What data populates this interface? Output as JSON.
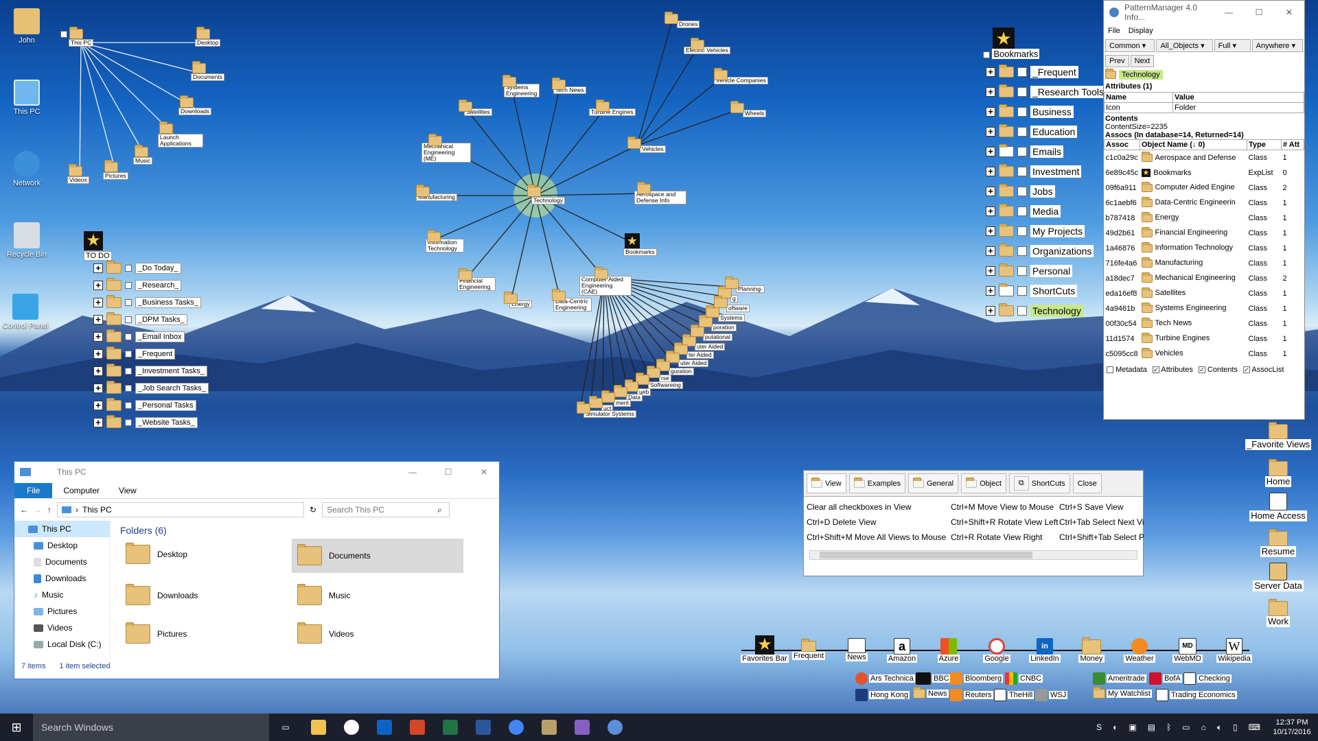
{
  "desktop": {
    "icons": [
      {
        "label": "John"
      },
      {
        "label": "This PC"
      },
      {
        "label": "Network"
      },
      {
        "label": "Recycle Bin"
      },
      {
        "label": "Control Panel"
      }
    ],
    "thispc_tree": {
      "root": "This PC",
      "children": [
        "Desktop",
        "Documents",
        "Downloads",
        "Launch Applications",
        "Music",
        "Pictures",
        "Videos"
      ]
    },
    "todo": {
      "root": "TO DO",
      "items": [
        "_Do Today_",
        "_Research_",
        "_Business Tasks_",
        "_DPM Tasks_",
        "_Email Inbox",
        "_Frequent",
        "_Investment Tasks_",
        "_Job Search Tasks_",
        "_Personal Tasks",
        "_Website Tasks_"
      ]
    },
    "tech_graph": {
      "center": "Technology",
      "nodes": [
        "Drones",
        "Electric Vehicles",
        "Vehicle Companies",
        "Wheels",
        "Vehicles",
        "Tech News",
        "Systems Engineering",
        "Turbine Engines",
        "Satellites",
        "Mechanical Engineering (ME)",
        "Manufacturing",
        "Aerospace and Defense Info",
        "Bookmarks",
        "Information Technology",
        "Financial Engineering",
        "Energy",
        "Data-Centric Engineering",
        "Computer Aided Engineering (CAE)"
      ],
      "cae_children_visible": [
        "Planning-",
        "g",
        "oftware",
        "Systems",
        "poration",
        "putational",
        "uter Aided",
        "ter Aided",
        "uter Aided",
        "guration",
        "rse",
        "Softwareing",
        "ueb",
        "Data",
        "ment",
        "uct",
        "Simulator Systems"
      ]
    },
    "bookmarks": {
      "root": "Bookmarks",
      "items": [
        "_Frequent",
        "_Research Tools",
        "Business",
        "Education",
        "Emails",
        "Investment",
        "Jobs",
        "Media",
        "My Projects",
        "Organizations",
        "Personal",
        "ShortCuts",
        "Technology"
      ]
    },
    "right_column": [
      "_Favorite Views",
      "Home",
      "Home Access",
      "Resume",
      "Server Data",
      "Work"
    ]
  },
  "pattern_manager": {
    "title": "PatternManager 4.0 Info...",
    "menu": [
      "File",
      "Display"
    ],
    "dropdowns": [
      "Common",
      "All_Objects",
      "Full",
      "Anywhere"
    ],
    "prev": "Prev",
    "next": "Next",
    "selected": "Technology",
    "attributes_header": "Attributes (1)",
    "attr_cols": [
      "Name",
      "Value"
    ],
    "attr_row": [
      "Icon",
      "Folder"
    ],
    "contents_header": "Contents",
    "content_size": "ContentSize=2235",
    "assocs_header": "Assocs (In database=14, Returned=14)",
    "assoc_cols": [
      "Assoc",
      "Object Name (↓ 0)",
      "Type",
      "# Att"
    ],
    "assocs": [
      [
        "c1c0a29c",
        "Aerospace and Defense",
        "Class",
        "1"
      ],
      [
        "6e89c45c",
        "Bookmarks",
        "ExpList",
        "0"
      ],
      [
        "09f6a911",
        "Computer Aided Engine",
        "Class",
        "2"
      ],
      [
        "6c1aebf6",
        "Data-Centric Engineerin",
        "Class",
        "1"
      ],
      [
        "b787418",
        "Energy",
        "Class",
        "1"
      ],
      [
        "49d2b61",
        "Financial Engineering",
        "Class",
        "1"
      ],
      [
        "1a46876",
        "Information Technology",
        "Class",
        "1"
      ],
      [
        "716fe4a6",
        "Manufacturing",
        "Class",
        "1"
      ],
      [
        "a18dec7",
        "Mechanical Engineering",
        "Class",
        "2"
      ],
      [
        "eda16ef8",
        "Satellites",
        "Class",
        "1"
      ],
      [
        "4a9461b",
        "Systems Engineering",
        "Class",
        "1"
      ],
      [
        "00f30c54",
        "Tech News",
        "Class",
        "1"
      ],
      [
        "11d1574",
        "Turbine Engines",
        "Class",
        "1"
      ],
      [
        "c5095cc8",
        "Vehicles",
        "Class",
        "1"
      ]
    ],
    "footer": [
      "Metadata",
      "Attributes",
      "Contents",
      "AssocList"
    ]
  },
  "explorer": {
    "title": "This PC",
    "tabs": [
      "File",
      "Computer",
      "View"
    ],
    "address": "This PC",
    "search_placeholder": "Search This PC",
    "nav": [
      "This PC",
      "Desktop",
      "Documents",
      "Downloads",
      "Music",
      "Pictures",
      "Videos",
      "Local Disk (C:)"
    ],
    "group": "Folders (6)",
    "folders": [
      "Desktop",
      "Documents",
      "Downloads",
      "Music",
      "Pictures",
      "Videos"
    ],
    "status_items": "7 items",
    "status_selected": "1 item selected"
  },
  "hotkeys": {
    "tabs": [
      "View",
      "Examples",
      "General",
      "Object",
      "ShortCuts",
      "Close"
    ],
    "rows": [
      [
        "Clear all checkboxes in View",
        "Ctrl+M  Move View to Mouse",
        "Ctrl+S  Save View"
      ],
      [
        "Ctrl+D  Delete View",
        "Ctrl+Shift+R  Rotate View Left",
        "Ctrl+Tab  Select Next Vi"
      ],
      [
        "Ctrl+Shift+M  Move All Views to Mouse",
        "Ctrl+R  Rotate View Right",
        "Ctrl+Shift+Tab  Select P"
      ]
    ]
  },
  "favorites": {
    "top": [
      "Favorites Bar",
      "Frequent",
      "News",
      "Amazon",
      "Azure",
      "Google",
      "LinkedIn",
      "Money",
      "Weather",
      "WebMD",
      "Wikipedia"
    ],
    "row1": [
      "Ars Technica",
      "BBC",
      "Bloomberg",
      "CNBC",
      "Ameritrade",
      "BofA",
      "Checking"
    ],
    "row2": [
      "Hong Kong",
      "News",
      "Reuters",
      "TheHill",
      "WSJ",
      "My Watchlist",
      "Trading Economics"
    ]
  },
  "taskbar": {
    "search": "Search Windows",
    "time": "12:37 PM",
    "date": "10/17/2016"
  }
}
